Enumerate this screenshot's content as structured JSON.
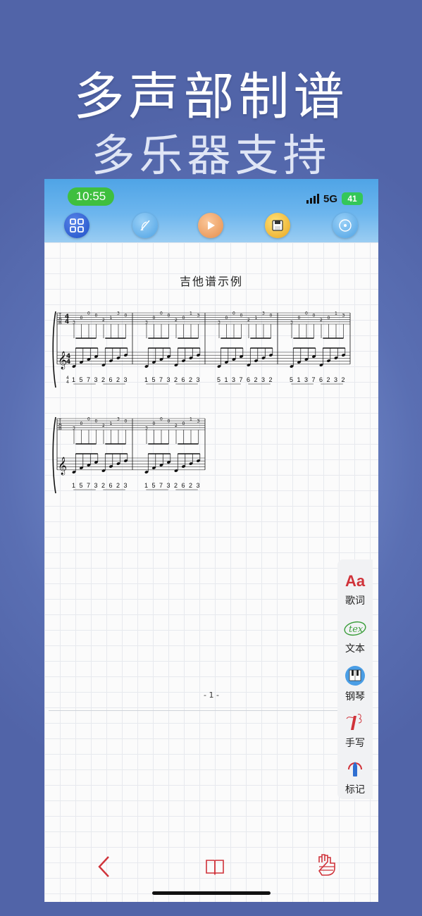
{
  "headline": {
    "line1": "多声部制谱",
    "line2": "多乐器支持"
  },
  "status_bar": {
    "time": "10:55",
    "network": "5G",
    "battery": "41"
  },
  "toolbar": {
    "icons": [
      "grid-icon",
      "tuner-icon",
      "play-icon",
      "save-icon",
      "disc-icon"
    ]
  },
  "score": {
    "title": "吉他谱示例",
    "page_label": "- 1 -",
    "tab_clef": [
      "T",
      "A",
      "B"
    ],
    "time_sig": {
      "top": "4",
      "bottom": "4"
    },
    "system1_numbers": [
      [
        "1",
        "5",
        "7",
        "3",
        "2",
        "6",
        "2",
        "3"
      ],
      [
        "1",
        "5",
        "7",
        "3",
        "2",
        "6",
        "2",
        "3"
      ],
      [
        "5",
        "1",
        "3",
        "7",
        "6",
        "2",
        "3",
        "2"
      ],
      [
        "5",
        "1",
        "3",
        "7",
        "6",
        "2",
        "3",
        "2"
      ]
    ],
    "system2_numbers": [
      [
        "1",
        "5",
        "7",
        "3",
        "2",
        "6",
        "2",
        "3"
      ],
      [
        "1",
        "5",
        "7",
        "3",
        "2",
        "6",
        "2",
        "3"
      ]
    ],
    "tab_frets": {
      "pattern_a": [
        "3",
        "0",
        "0",
        "0",
        "2",
        "1",
        "3",
        "0"
      ],
      "pattern_b": [
        "3",
        "0",
        "0",
        "0",
        "2",
        "0",
        "1",
        "3"
      ]
    }
  },
  "side_panel": {
    "items": [
      {
        "label": "歌词",
        "icon_text": "Aa"
      },
      {
        "label": "文本",
        "icon_text": "tex"
      },
      {
        "label": "钢琴",
        "icon_text": ""
      },
      {
        "label": "手写",
        "icon_text": ""
      },
      {
        "label": "标记",
        "icon_text": ""
      }
    ]
  },
  "bottom_bar": {
    "icons": [
      "back-icon",
      "book-icon",
      "hand-icon"
    ]
  },
  "colors": {
    "accent": "#d0333a",
    "toolbar": "#5aaaea",
    "background": "#5164a8"
  }
}
